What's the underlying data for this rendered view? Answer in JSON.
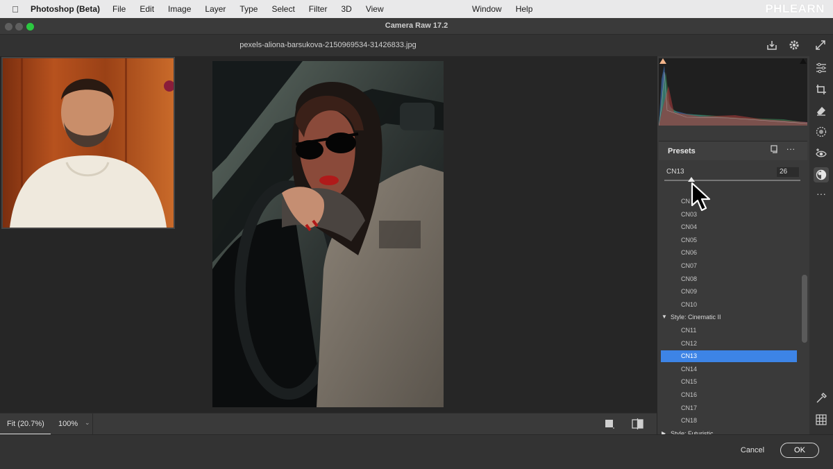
{
  "menubar": {
    "app_name": "Photoshop (Beta)",
    "items": [
      "File",
      "Edit",
      "Image",
      "Layer",
      "Type",
      "Select",
      "Filter",
      "3D",
      "View"
    ],
    "right_items": [
      "Window",
      "Help"
    ],
    "brand": "PHLEARN"
  },
  "window": {
    "title": "Camera Raw 17.2",
    "filename": "pexels-aliona-barsukova-2150969534-31426833.jpg"
  },
  "status": {
    "zoom_fit": "Fit (20.7%)",
    "zoom_100": "100%"
  },
  "presets": {
    "header": "Presets",
    "active_name": "CN13",
    "amount": "26",
    "amount_fraction": 0.2,
    "items": [
      {
        "label": "CN",
        "kind": "item"
      },
      {
        "label": "CN03",
        "kind": "item"
      },
      {
        "label": "CN04",
        "kind": "item"
      },
      {
        "label": "CN05",
        "kind": "item"
      },
      {
        "label": "CN06",
        "kind": "item"
      },
      {
        "label": "CN07",
        "kind": "item"
      },
      {
        "label": "CN08",
        "kind": "item"
      },
      {
        "label": "CN09",
        "kind": "item"
      },
      {
        "label": "CN10",
        "kind": "item"
      },
      {
        "label": "Style: Cinematic II",
        "kind": "group-open"
      },
      {
        "label": "CN11",
        "kind": "item"
      },
      {
        "label": "CN12",
        "kind": "item"
      },
      {
        "label": "CN13",
        "kind": "item",
        "selected": true
      },
      {
        "label": "CN14",
        "kind": "item"
      },
      {
        "label": "CN15",
        "kind": "item"
      },
      {
        "label": "CN16",
        "kind": "item"
      },
      {
        "label": "CN17",
        "kind": "item"
      },
      {
        "label": "CN18",
        "kind": "item"
      },
      {
        "label": "Style: Futuristic",
        "kind": "group-closed"
      }
    ]
  },
  "footer": {
    "cancel_label": "Cancel",
    "ok_label": "OK"
  },
  "colors": {
    "selection": "#3d84e6",
    "traffic_close": "#5f5f5f",
    "traffic_min": "#5f5f5f",
    "traffic_max": "#2bc840"
  },
  "icons": [
    "apple-icon",
    "save-icon",
    "gear-icon",
    "fullscreen-icon",
    "edit-sliders-icon",
    "crop-icon",
    "eraser-icon",
    "masking-icon",
    "red-eye-icon",
    "presets-icon",
    "more-icon",
    "eyedropper-icon",
    "grid-icon",
    "before-after-icon",
    "overlay-icon",
    "preset-add-icon",
    "preset-more-icon"
  ]
}
